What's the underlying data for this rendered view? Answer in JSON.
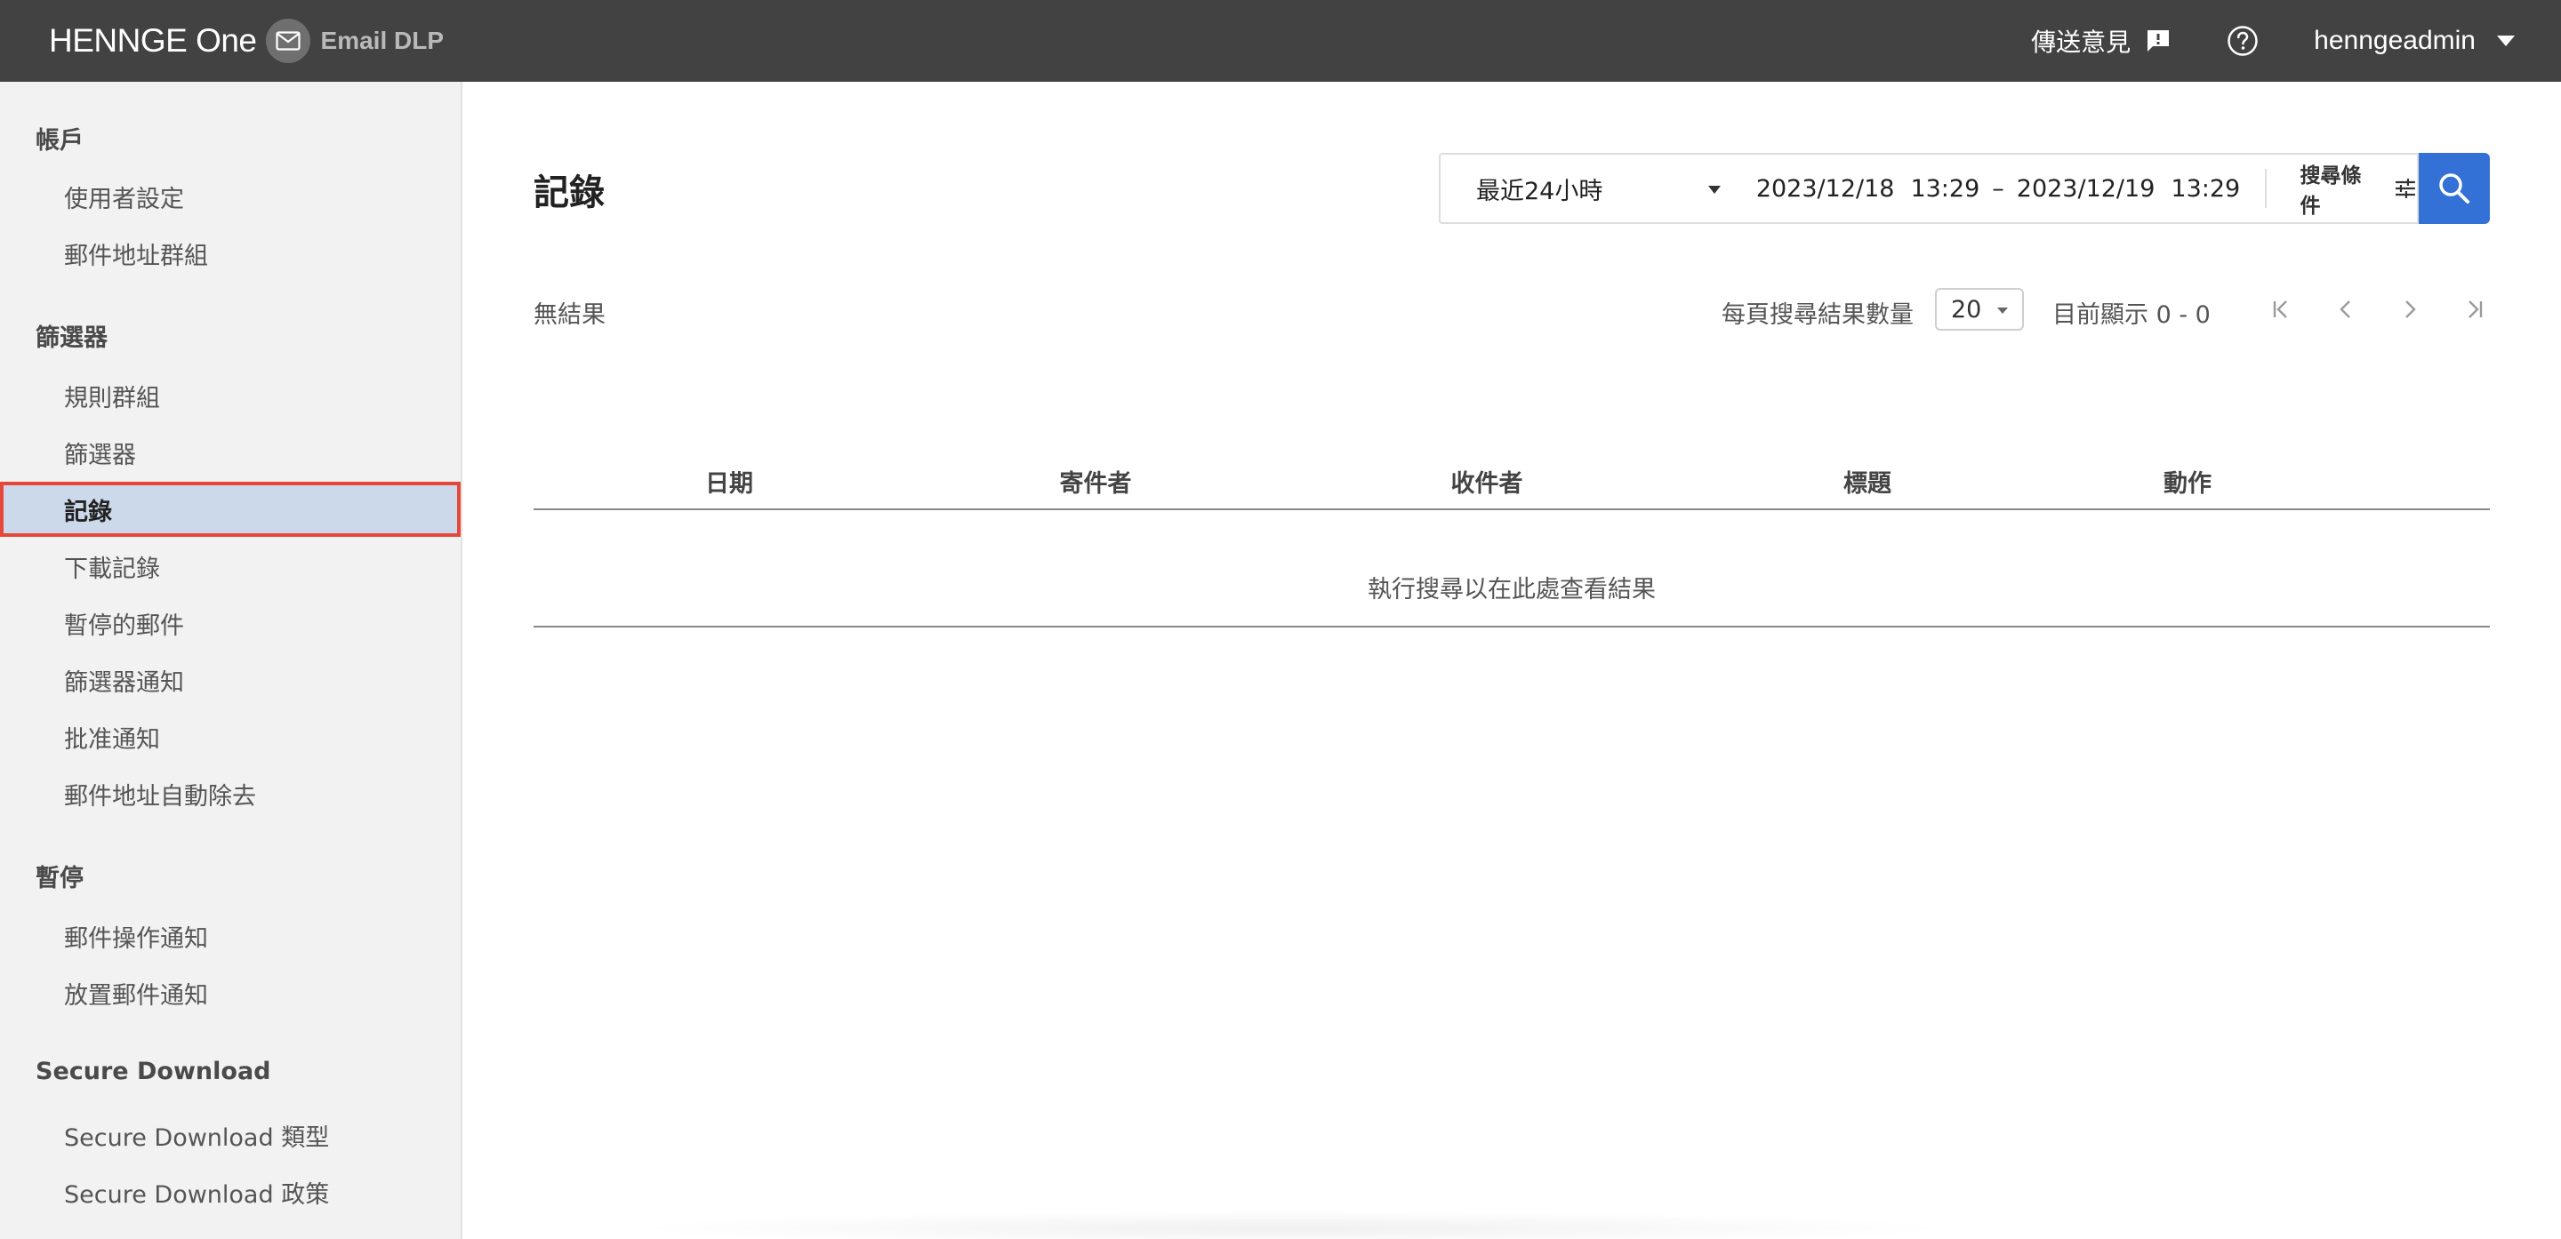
{
  "header": {
    "brand_name": "HENNGE One",
    "product_name": "Email DLP",
    "feedback_label": "傳送意見",
    "username": "henngeadmin"
  },
  "sidebar": {
    "sections": [
      {
        "title": "帳戶",
        "items": [
          {
            "label": "使用者設定"
          },
          {
            "label": "郵件地址群組"
          }
        ]
      },
      {
        "title": "篩選器",
        "items": [
          {
            "label": "規則群組"
          },
          {
            "label": "篩選器"
          },
          {
            "label": "記錄",
            "active": true
          },
          {
            "label": "下載記錄"
          },
          {
            "label": "暫停的郵件"
          },
          {
            "label": "篩選器通知"
          },
          {
            "label": "批准通知"
          },
          {
            "label": "郵件地址自動除去"
          }
        ]
      },
      {
        "title": "暫停",
        "items": [
          {
            "label": "郵件操作通知"
          },
          {
            "label": "放置郵件通知"
          }
        ]
      },
      {
        "title": "Secure Download",
        "items": [
          {
            "label": "Secure Download 類型"
          },
          {
            "label": "Secure Download 政策"
          }
        ]
      }
    ]
  },
  "main": {
    "page_title": "記錄",
    "filter": {
      "range_selected": "最近24小時",
      "start_date": "2023/12/18",
      "start_time": "13:29",
      "separator": "–",
      "end_date": "2023/12/19",
      "end_time": "13:29",
      "conditions_label": "搜尋條件"
    },
    "results": {
      "no_result_text": "無結果",
      "per_page_label": "每頁搜尋結果數量",
      "per_page_value": "20",
      "showing_text": "目前顯示 0 - 0"
    },
    "table": {
      "columns": [
        "日期",
        "寄件者",
        "收件者",
        "標題",
        "動作"
      ],
      "empty_message": "執行搜尋以在此處查看結果"
    }
  },
  "colors": {
    "topbar": "#424242",
    "sidebar": "#f2f2f2",
    "active_item_bg": "#ccd9ea",
    "active_item_border": "#e5483a",
    "search_button": "#3371d6"
  },
  "icons": {
    "feedback": "feedback-bubble-icon",
    "help": "help-circle-icon",
    "user_menu": "caret-down-icon",
    "conditions": "sliders-icon",
    "search": "search-icon",
    "first_page": "first-page-icon",
    "prev_page": "prev-page-icon",
    "next_page": "next-page-icon",
    "last_page": "last-page-icon"
  }
}
